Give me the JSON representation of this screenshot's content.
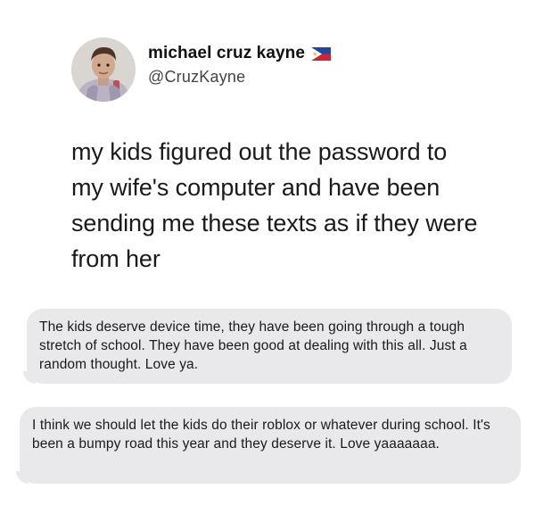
{
  "tweet": {
    "display_name": "michael cruz kayne",
    "handle": "@CruzKayne",
    "flag_icon": "philippines-flag-icon",
    "text": "my kids figured out the password to my wife's computer and have been sending me these texts as if they were from her"
  },
  "messages": [
    {
      "text": "The kids deserve device time, they have been going through a tough stretch of school. They have been good at dealing with this all. Just a random thought. Love ya."
    },
    {
      "text": "I think we should let the kids do their roblox or whatever during school. It's been a bumpy road this year and they deserve it. Love yaaaaaaa."
    }
  ],
  "colors": {
    "bubble_bg": "#e9e9eb",
    "text": "#1a1a1a",
    "handle": "#444444"
  }
}
